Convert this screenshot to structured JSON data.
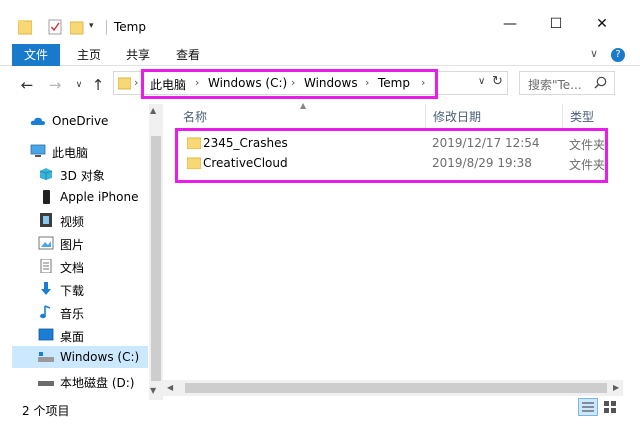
{
  "window": {
    "title": "Temp",
    "minimize": "—",
    "maximize": "☐",
    "close": "✕"
  },
  "ribbon": {
    "tabs": [
      "文件",
      "主页",
      "共享",
      "查看"
    ],
    "expand": "∨",
    "help": "?"
  },
  "address": {
    "breadcrumbs": [
      "此电脑",
      "Windows (C:)",
      "Windows",
      "Temp"
    ],
    "separator": "›"
  },
  "search": {
    "placeholder": "搜索\"Te..."
  },
  "nav": {
    "items": [
      {
        "label": "OneDrive",
        "icon": "cloud-icon"
      },
      {
        "label": "此电脑",
        "icon": "computer-icon"
      },
      {
        "label": "3D 对象",
        "icon": "cube-icon"
      },
      {
        "label": "Apple iPhone",
        "icon": "phone-icon"
      },
      {
        "label": "视频",
        "icon": "video-icon"
      },
      {
        "label": "图片",
        "icon": "picture-icon"
      },
      {
        "label": "文档",
        "icon": "document-icon"
      },
      {
        "label": "下载",
        "icon": "download-icon"
      },
      {
        "label": "音乐",
        "icon": "music-icon"
      },
      {
        "label": "桌面",
        "icon": "desktop-icon"
      },
      {
        "label": "Windows (C:)",
        "icon": "drive-icon"
      },
      {
        "label": "本地磁盘 (D:)",
        "icon": "drive-icon"
      }
    ],
    "selected": "Windows (C:)"
  },
  "columns": {
    "name": "名称",
    "modified": "修改日期",
    "type": "类型"
  },
  "files": [
    {
      "name": "2345_Crashes",
      "modified": "2019/12/17 12:54",
      "type": "文件夹"
    },
    {
      "name": "CreativeCloud",
      "modified": "2019/8/29 19:38",
      "type": "文件夹"
    }
  ],
  "status": {
    "count": "2 个项目"
  },
  "colors": {
    "accent": "#1979ca",
    "highlight": "#e81de8",
    "folder": "#f8d775",
    "selection": "#cce8ff"
  }
}
